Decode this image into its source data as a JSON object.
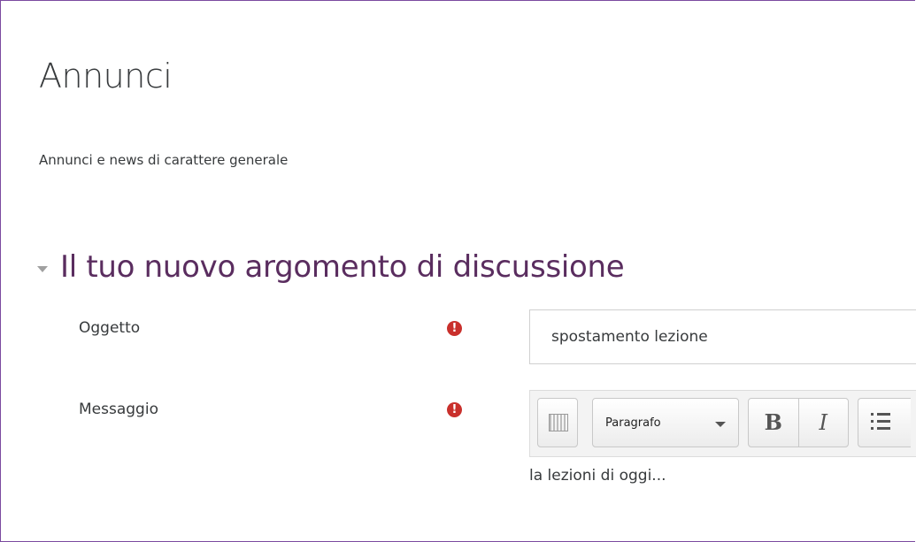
{
  "page": {
    "title": "Annunci",
    "intro": "Annunci e news di carattere generale"
  },
  "section": {
    "title": "Il tuo nuovo argomento di discussione"
  },
  "form": {
    "subject_label": "Oggetto",
    "subject_value": "spostamento lezione",
    "message_label": "Messaggio",
    "required_glyph": "!",
    "message_text": "la lezioni di oggi..."
  },
  "toolbar": {
    "paragraph_label": "Paragrafo",
    "bold_label": "B",
    "italic_label": "I",
    "icons": [
      "keyboard-icon",
      "bold-icon",
      "italic-icon",
      "bullet-list-icon"
    ]
  },
  "colors": {
    "frame": "#7b4aa0",
    "section_title": "#5a2d5f",
    "required": "#c9302c"
  }
}
